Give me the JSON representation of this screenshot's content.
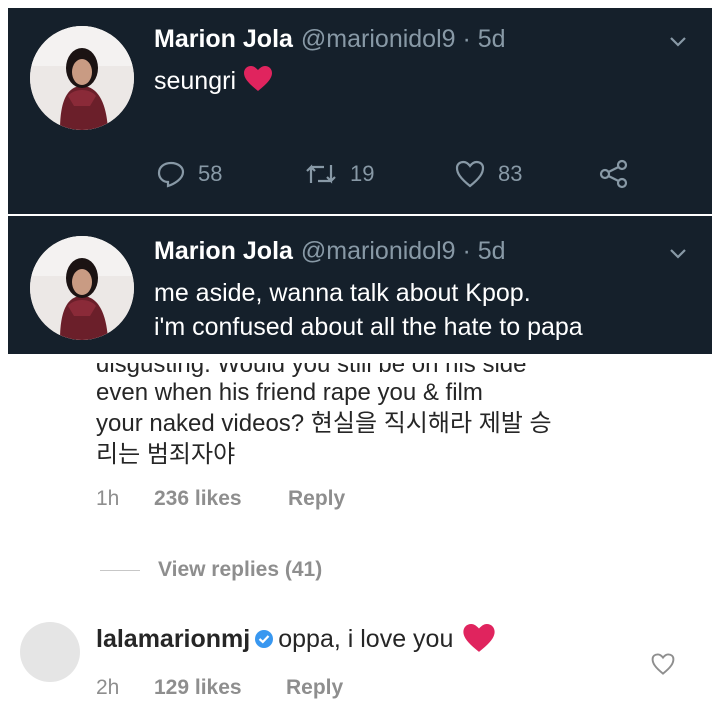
{
  "tweet1": {
    "name": "Marion Jola",
    "handle": "@marionidol9 · 5d",
    "text": "seungri",
    "replies": "58",
    "retweets": "19",
    "likes": "83"
  },
  "tweet2": {
    "name": "Marion Jola",
    "handle": "@marionidol9 · 5d",
    "line1": "me aside, wanna talk about Kpop.",
    "line2": "i'm confused about all the hate to papa"
  },
  "comment": {
    "cut_line": "disgusting. Would you still be on his side",
    "line1": "even when his friend rape you & film",
    "line2": "your naked videos? 현실을 직시해라 제발 승",
    "line3": "리는 범죄자야",
    "time": "1h",
    "likes": "236 likes",
    "reply": "Reply",
    "view_replies": "View replies (41)"
  },
  "reply_comment": {
    "username": "lalamarionmj",
    "text": "oppa, i love you",
    "time": "2h",
    "likes": "129 likes",
    "reply": "Reply"
  },
  "colors": {
    "tweet_bg": "#15202b",
    "heart_red": "#e0245e",
    "verified_blue": "#3897f0"
  }
}
